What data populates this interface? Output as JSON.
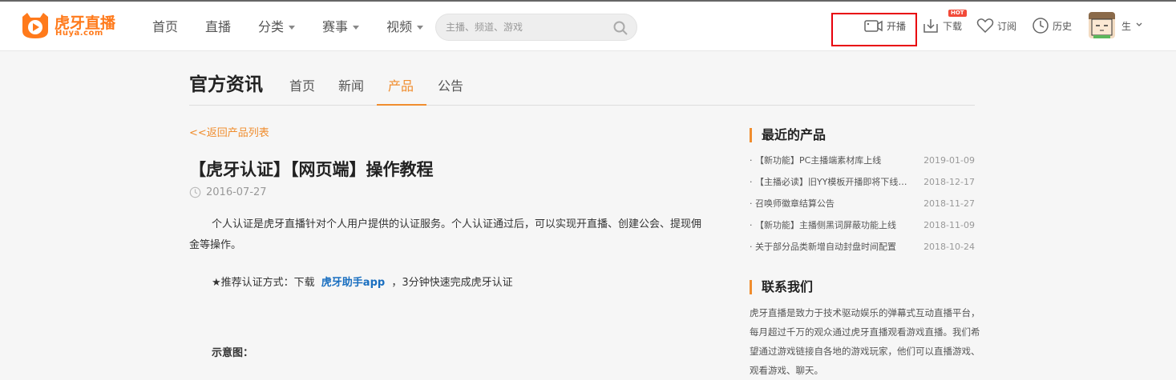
{
  "header": {
    "logo_text": "虎牙直播",
    "logo_sub": "Huya.com",
    "nav": [
      {
        "label": "首页",
        "has_dropdown": false
      },
      {
        "label": "直播",
        "has_dropdown": false
      },
      {
        "label": "分类",
        "has_dropdown": true
      },
      {
        "label": "赛事",
        "has_dropdown": true
      },
      {
        "label": "视频",
        "has_dropdown": true
      }
    ],
    "search_placeholder": "主播、频道、游戏",
    "tools": {
      "start_label": "开播",
      "download_label": "下载",
      "download_badge": "HOT",
      "subscribe_label": "订阅",
      "history_label": "历史"
    },
    "user_name": "生"
  },
  "subnav": {
    "title": "官方资讯",
    "tabs": [
      {
        "label": "首页",
        "active": false
      },
      {
        "label": "新闻",
        "active": false
      },
      {
        "label": "产品",
        "active": true
      },
      {
        "label": "公告",
        "active": false
      }
    ]
  },
  "article": {
    "back_link": "<<返回产品列表",
    "title": "【虎牙认证】【网页端】操作教程",
    "date": "2016-07-27",
    "paragraph": "个人认证是虎牙直播针对个人用户提供的认证服务。个人认证通过后，可以实现开直播、创建公会、提现佣金等操作。",
    "recommend_prefix": "★推荐认证方式：下载",
    "recommend_link": "虎牙助手app",
    "recommend_suffix": "，3分钟快速完成虎牙认证",
    "diagram_label": "示意图："
  },
  "sidebar": {
    "recent_heading": "最近的产品",
    "recent": [
      {
        "title": "· 【新功能】PC主播端素材库上线",
        "date": "2019-01-09"
      },
      {
        "title": "· 【主播必读】旧YY模板开播即将下线通知",
        "date": "2018-12-17"
      },
      {
        "title": "· 召唤师徽章结算公告",
        "date": "2018-11-27"
      },
      {
        "title": "· 【新功能】主播侧黑词屏蔽功能上线",
        "date": "2018-11-09"
      },
      {
        "title": "· 关于部分品类新增自动封盘时间配置",
        "date": "2018-10-24"
      }
    ],
    "contact_heading": "联系我们",
    "contact_text": "虎牙直播是致力于技术驱动娱乐的弹幕式互动直播平台，每月超过千万的观众通过虎牙直播观看游戏直播。我们希望通过游戏链接自各地的游戏玩家，他们可以直播游戏、观看游戏、聊天。"
  },
  "colors": {
    "accent": "#f08d2e",
    "brand": "#ff7a1b",
    "link": "#1a6fc0",
    "highlight_box": "#e8000b"
  }
}
